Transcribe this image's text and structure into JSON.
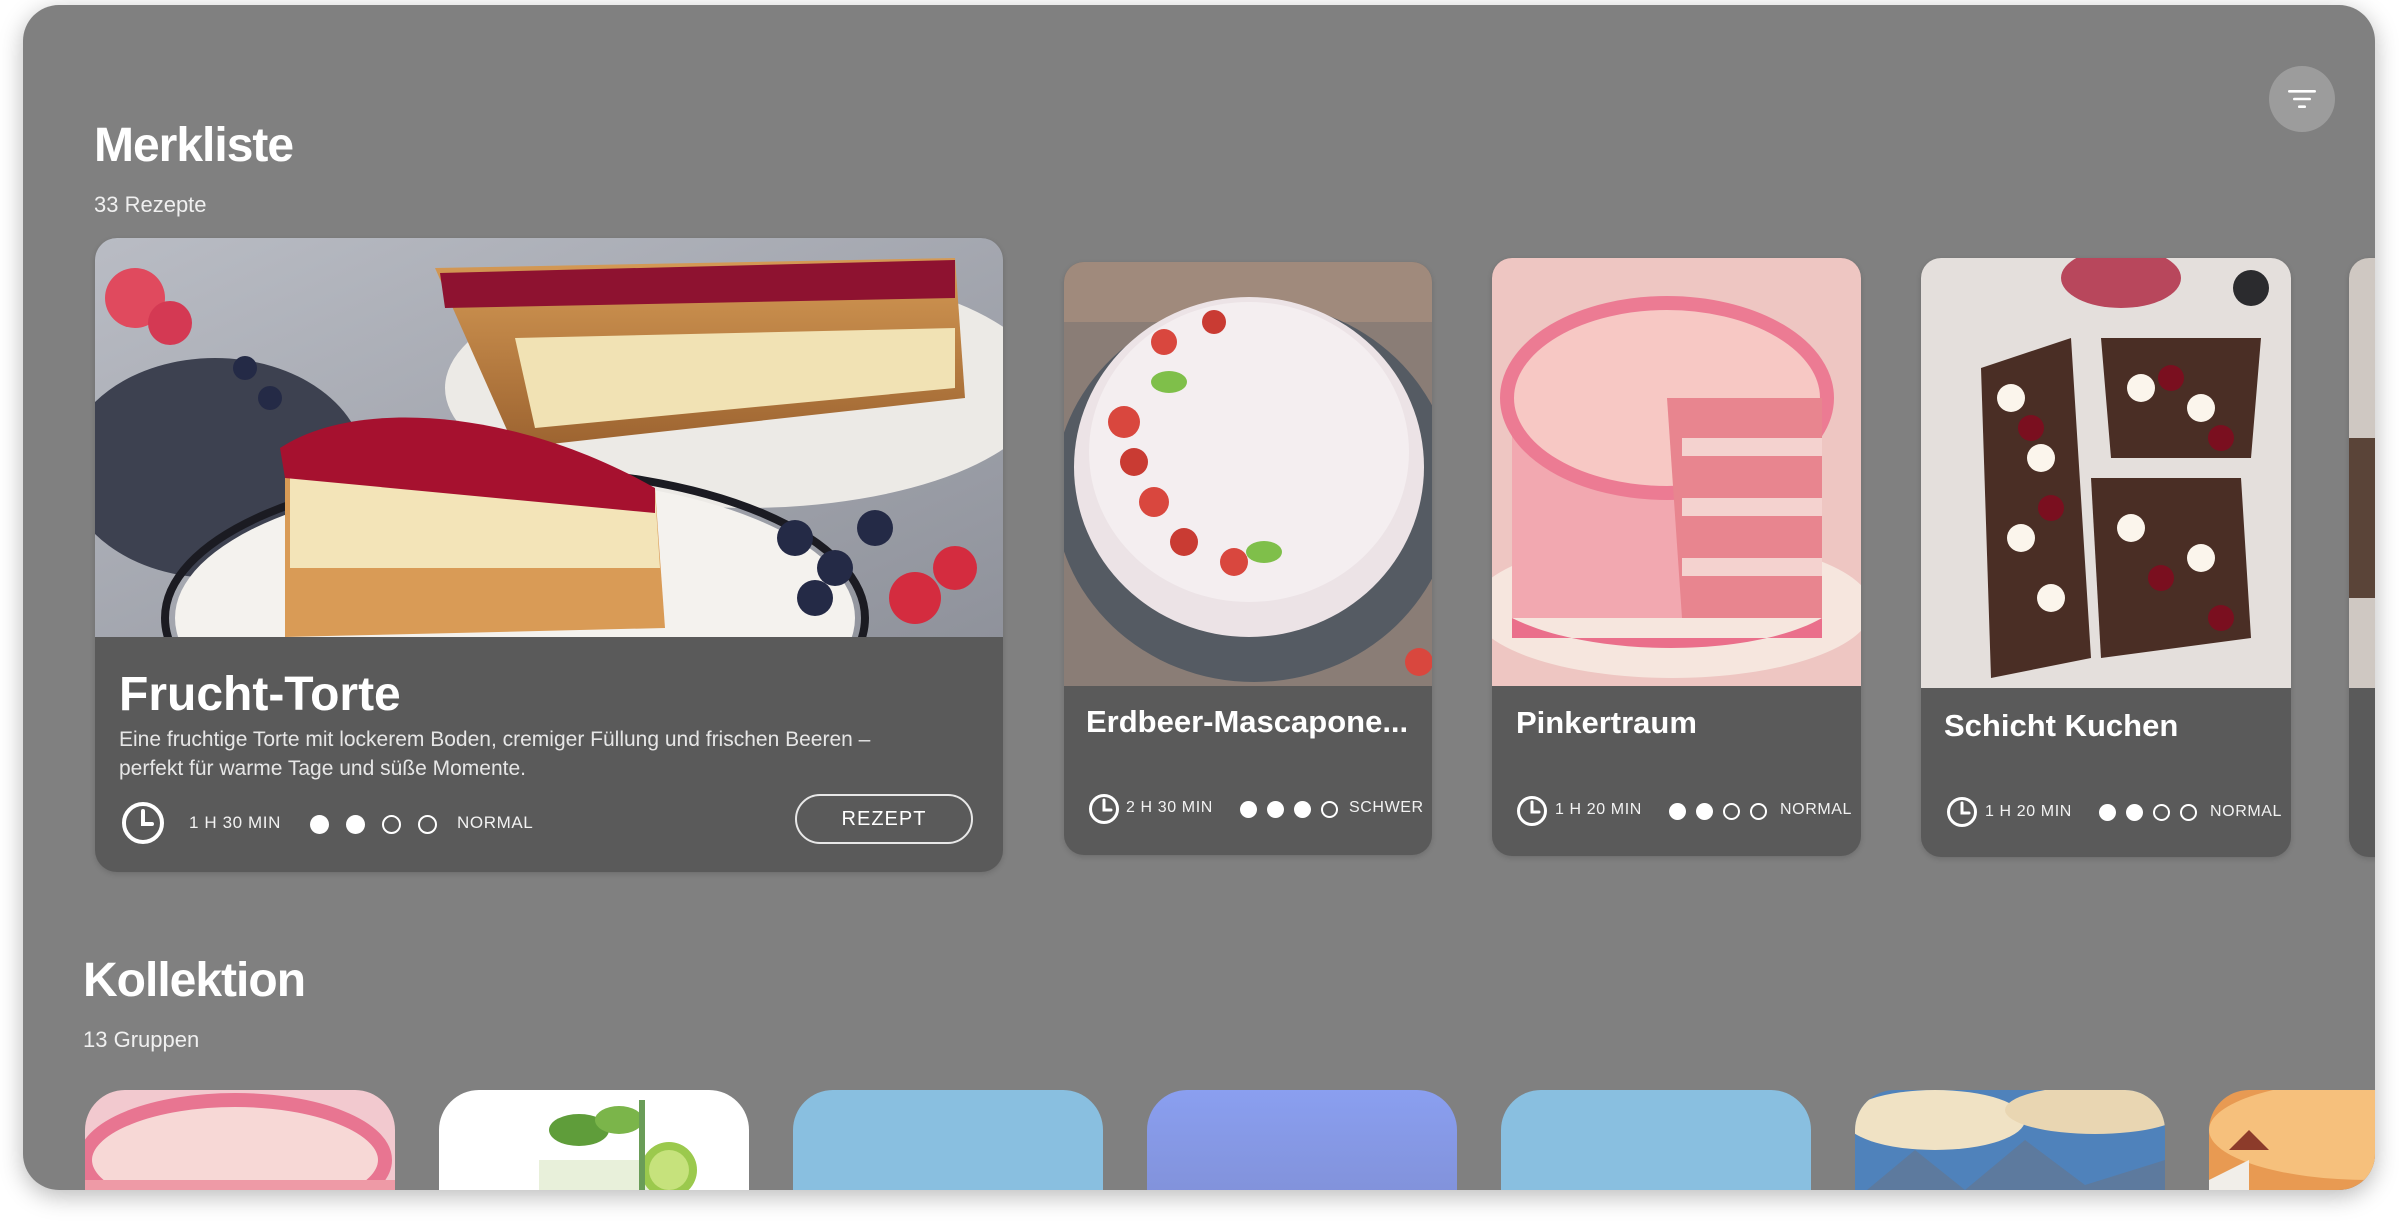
{
  "header": {
    "filter_icon": "filter-lines-icon"
  },
  "merkliste": {
    "title": "Merkliste",
    "subtitle": "33 Rezepte"
  },
  "recipes": [
    {
      "title": "Frucht-Torte",
      "description_line1": "Eine fruchtige Torte mit lockerem Boden, cremiger Füllung und frischen Beeren –",
      "description_line2": "perfekt für warme Tage und süße Momente.",
      "time": "1 H 30 MIN",
      "difficulty_level": 2,
      "difficulty_max": 4,
      "difficulty": "NORMAL",
      "button": "REZEPT",
      "image": "fruit-tart-photo"
    },
    {
      "title": "Erdbeer-Mascapone...",
      "time": "2 H 30 MIN",
      "difficulty_level": 3,
      "difficulty_max": 4,
      "difficulty": "SCHWER",
      "image": "strawberry-mascarpone-cake-photo"
    },
    {
      "title": "Pinkertraum",
      "time": "1 H 20 MIN",
      "difficulty_level": 2,
      "difficulty_max": 4,
      "difficulty": "NORMAL",
      "image": "pink-layer-cake-photo"
    },
    {
      "title": "Schicht Kuchen",
      "time": "1 H 20 MIN",
      "difficulty_level": 2,
      "difficulty_max": 4,
      "difficulty": "NORMAL",
      "image": "cherry-chocolate-layer-cake-photo"
    }
  ],
  "kollektion": {
    "title": "Kollektion",
    "subtitle": "13 Gruppen"
  },
  "collections": [
    {
      "image": "pink-cake-thumbnail",
      "color": "#f2c9cf"
    },
    {
      "image": "mojito-drink-thumbnail",
      "color": "#ffffff"
    },
    {
      "image": "plain-blue",
      "color": "#89bfe0"
    },
    {
      "image": "blue-purple-gradient",
      "color": "#8a9be8"
    },
    {
      "image": "plain-blue",
      "color": "#89bfe0"
    },
    {
      "image": "mountain-sky-thumbnail",
      "color": "#5e8fc2"
    },
    {
      "image": "sunset-village-thumbnail",
      "color": "#e89a52"
    }
  ]
}
